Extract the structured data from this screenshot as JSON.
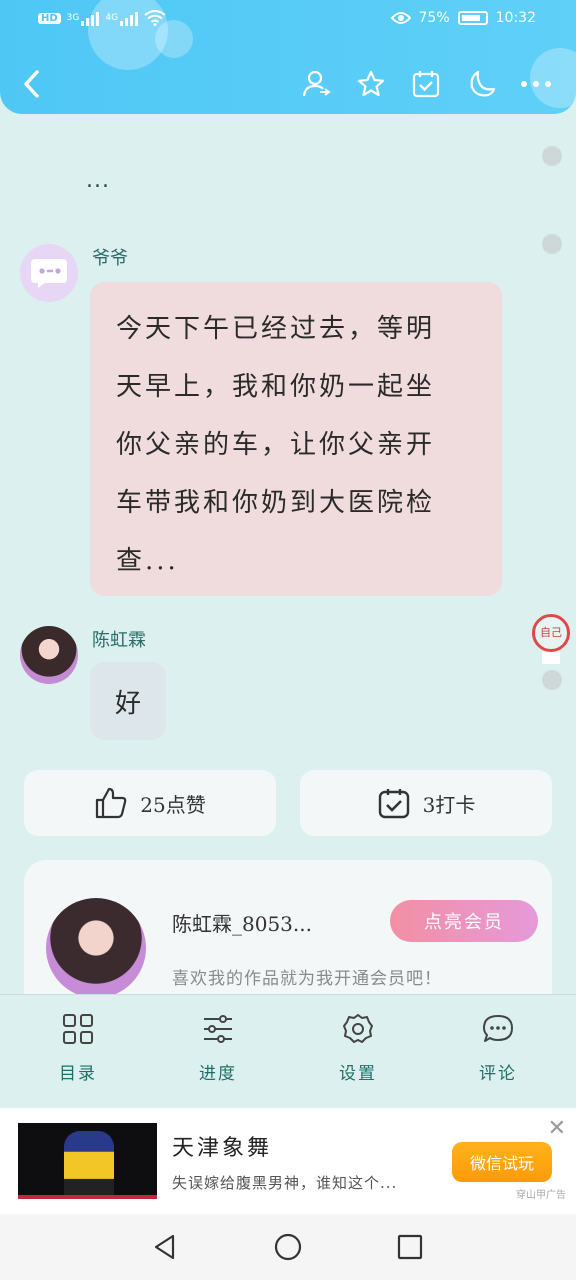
{
  "status_bar": {
    "badge": "HD",
    "network_1": "3G",
    "network_2": "4G",
    "battery_pct": "75%",
    "time": "10:32"
  },
  "colors": {
    "header": "#4fc7f5",
    "background": "#dcf0ef",
    "accent_text": "#1f6f66",
    "member_btn": "#f28fa4",
    "ad_btn": "#ff9a0a"
  },
  "toolbar": {
    "icons": [
      "back-icon",
      "user-switch-icon",
      "star-icon",
      "calendar-check-icon",
      "moon-icon",
      "more-icon"
    ]
  },
  "chat": {
    "leading_ellipsis": "...",
    "messages": [
      {
        "speaker": "爷爷",
        "text_lines": [
          "今天下午已经过去，等明",
          "天早上，我和你奶一起坐",
          "你父亲的车，让你父亲开",
          "车带我和你奶到大医院检",
          "查..."
        ]
      },
      {
        "speaker": "陈虹霖",
        "text": "好"
      }
    ],
    "stamp_text": "自己"
  },
  "actions": {
    "like_label": "25点赞",
    "checkin_label": "3打卡"
  },
  "author": {
    "name": "陈虹霖_8053...",
    "description": "喜欢我的作品就为我开通会员吧！",
    "member_button": "点亮会员"
  },
  "tabs": [
    {
      "label": "目录",
      "icon": "grid-icon"
    },
    {
      "label": "进度",
      "icon": "sliders-icon"
    },
    {
      "label": "设置",
      "icon": "settings-icon"
    },
    {
      "label": "评论",
      "icon": "comment-icon"
    }
  ],
  "ad": {
    "title": "天津象舞",
    "description": "失误嫁给腹黑男神，谁知这个...",
    "button": "微信试玩",
    "source": "穿山甲广告"
  }
}
